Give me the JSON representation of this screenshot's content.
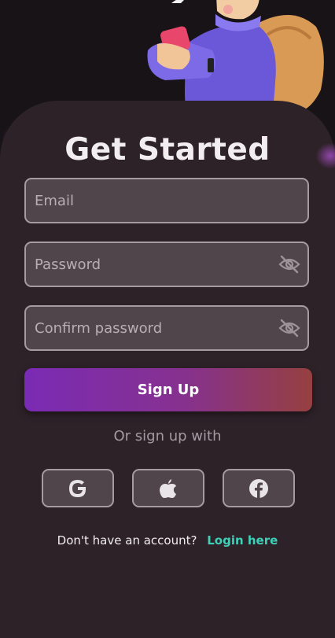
{
  "header": {
    "title": "Get Started"
  },
  "form": {
    "email_placeholder": "Email",
    "password_placeholder": "Password",
    "confirm_placeholder": "Confirm password",
    "password_toggle_icon": "eye-off-icon",
    "signup_label": "Sign Up"
  },
  "social": {
    "divider_text": "Or sign up with",
    "providers": [
      {
        "name": "Google",
        "icon": "google-icon"
      },
      {
        "name": "Apple",
        "icon": "apple-icon"
      },
      {
        "name": "Facebook",
        "icon": "facebook-icon"
      }
    ]
  },
  "footer": {
    "question": "Don't have an account?",
    "login_link": "Login here"
  },
  "colors": {
    "background": "#181317",
    "sheet": "#2e2229",
    "field_bg": "#51454c",
    "field_border": "#a59ba1",
    "accent_link": "#3fd0b8",
    "button_gradient_start": "#7a2bb4",
    "button_gradient_end": "#964040"
  }
}
